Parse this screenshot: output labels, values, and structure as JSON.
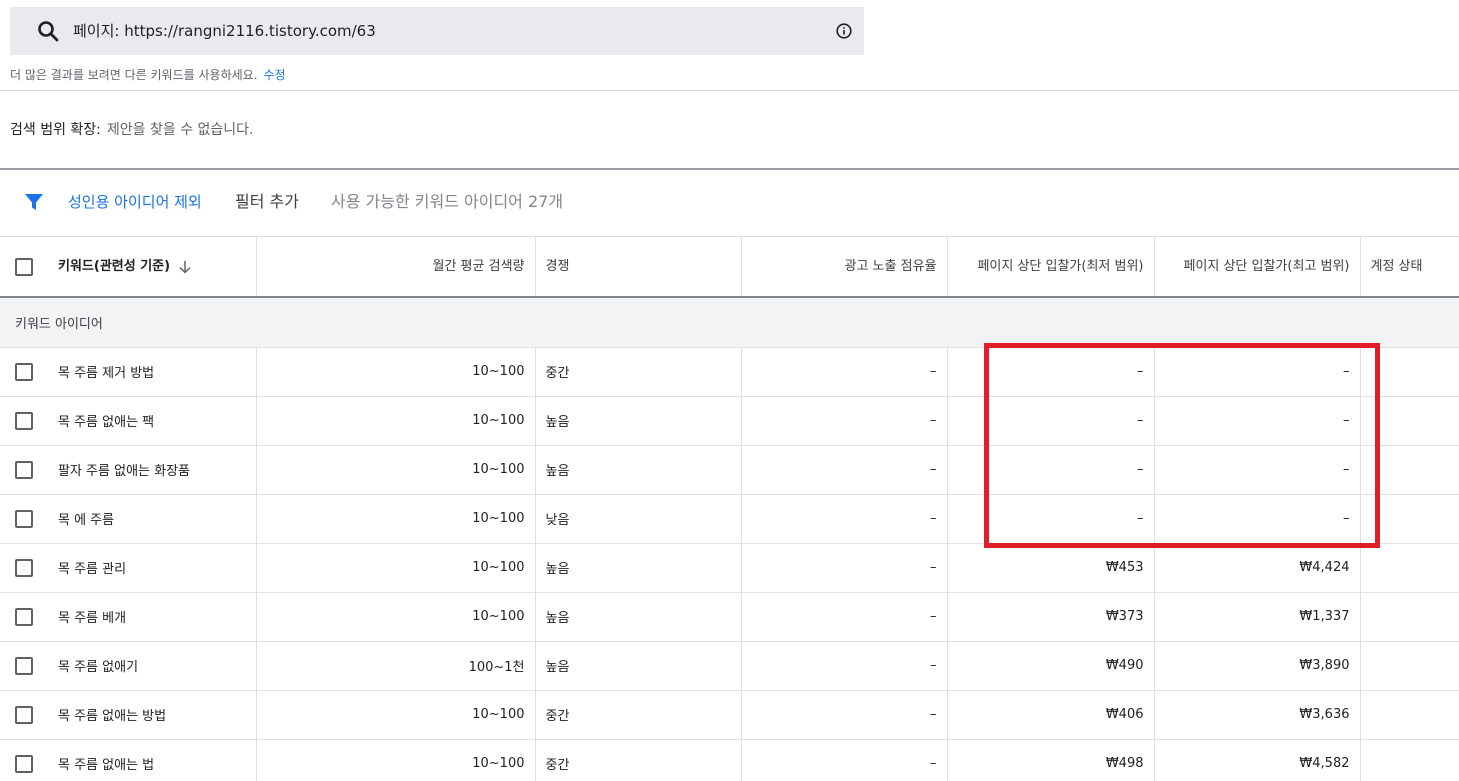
{
  "search": {
    "text": "페이지: https://rangni2116.tistory.com/63"
  },
  "hint": {
    "text": "더 많은 결과를 보려면 다른 키워드를 사용하세요.",
    "edit_label": "수정"
  },
  "expand": {
    "label": "검색 범위 확장:",
    "value": "제안을 찾을 수 없습니다."
  },
  "filter": {
    "chip_label": "성인용 아이디어 제외",
    "add_label": "필터 추가",
    "count_text": "사용 가능한 키워드 아이디어 27개"
  },
  "table": {
    "headers": {
      "keyword": "키워드(관련성 기준)",
      "monthly_searches": "월간 평균 검색량",
      "competition": "경쟁",
      "impression_share": "광고 노출 점유율",
      "top_bid_low": "페이지 상단 입찰가(최저 범위)",
      "top_bid_high": "페이지 상단 입찰가(최고 범위)",
      "account_status": "계정 상태"
    },
    "group_label": "키워드 아이디어",
    "rows": [
      {
        "keyword": "목 주름 제거 방법",
        "searches": "10~100",
        "competition": "중간",
        "share": "–",
        "low": "–",
        "high": "–"
      },
      {
        "keyword": "목 주름 없애는 팩",
        "searches": "10~100",
        "competition": "높음",
        "share": "–",
        "low": "–",
        "high": "–"
      },
      {
        "keyword": "팔자 주름 없애는 화장품",
        "searches": "10~100",
        "competition": "높음",
        "share": "–",
        "low": "–",
        "high": "–"
      },
      {
        "keyword": "목 에 주름",
        "searches": "10~100",
        "competition": "낮음",
        "share": "–",
        "low": "–",
        "high": "–"
      },
      {
        "keyword": "목 주름 관리",
        "searches": "10~100",
        "competition": "높음",
        "share": "–",
        "low": "₩453",
        "high": "₩4,424"
      },
      {
        "keyword": "목 주름 베개",
        "searches": "10~100",
        "competition": "높음",
        "share": "–",
        "low": "₩373",
        "high": "₩1,337"
      },
      {
        "keyword": "목 주름 없애기",
        "searches": "100~1천",
        "competition": "높음",
        "share": "–",
        "low": "₩490",
        "high": "₩3,890"
      },
      {
        "keyword": "목 주름 없애는 방법",
        "searches": "10~100",
        "competition": "중간",
        "share": "–",
        "low": "₩406",
        "high": "₩3,636"
      },
      {
        "keyword": "목 주름 없애는 법",
        "searches": "10~100",
        "competition": "중간",
        "share": "–",
        "low": "₩498",
        "high": "₩4,582"
      }
    ]
  },
  "colors": {
    "accent": "#1a73e8",
    "highlight_box": "#e11d2a",
    "search_bg": "#e8eaed",
    "group_bg": "#f1f3f4"
  },
  "icons": {
    "search": "search-icon",
    "info": "info-icon",
    "filter": "filter-icon",
    "sort": "arrow-down-icon"
  }
}
